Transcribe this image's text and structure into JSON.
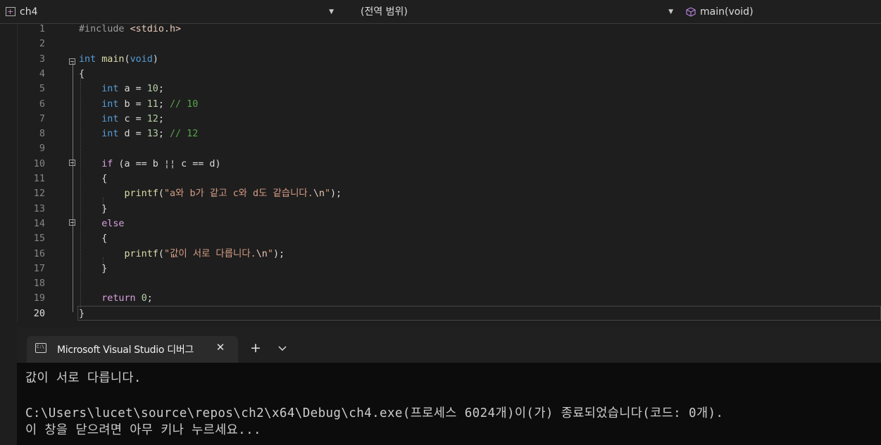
{
  "navbar": {
    "project": "ch4",
    "scope": "(전역 범위)",
    "member": "main(void)"
  },
  "editor": {
    "line_numbers": [
      "1",
      "2",
      "3",
      "4",
      "5",
      "6",
      "7",
      "8",
      "9",
      "10",
      "11",
      "12",
      "13",
      "14",
      "15",
      "16",
      "17",
      "18",
      "19",
      "20"
    ],
    "active_line": "20",
    "lines": [
      [
        {
          "t": "#include ",
          "c": "pp"
        },
        {
          "t": "<stdio.h>",
          "c": "inc"
        }
      ],
      [],
      [
        {
          "t": "int",
          "c": "kw"
        },
        {
          "t": " ",
          "c": ""
        },
        {
          "t": "main",
          "c": "fn"
        },
        {
          "t": "(",
          "c": ""
        },
        {
          "t": "void",
          "c": "kw"
        },
        {
          "t": ")",
          "c": ""
        }
      ],
      [
        {
          "t": "{",
          "c": ""
        }
      ],
      [
        {
          "t": "    ",
          "c": ""
        },
        {
          "t": "int",
          "c": "kw"
        },
        {
          "t": " a = ",
          "c": ""
        },
        {
          "t": "10",
          "c": "num"
        },
        {
          "t": ";",
          "c": ""
        }
      ],
      [
        {
          "t": "    ",
          "c": ""
        },
        {
          "t": "int",
          "c": "kw"
        },
        {
          "t": " b = ",
          "c": ""
        },
        {
          "t": "11",
          "c": "num"
        },
        {
          "t": "; ",
          "c": ""
        },
        {
          "t": "// 10",
          "c": "cmt"
        }
      ],
      [
        {
          "t": "    ",
          "c": ""
        },
        {
          "t": "int",
          "c": "kw"
        },
        {
          "t": " c = ",
          "c": ""
        },
        {
          "t": "12",
          "c": "num"
        },
        {
          "t": ";",
          "c": ""
        }
      ],
      [
        {
          "t": "    ",
          "c": ""
        },
        {
          "t": "int",
          "c": "kw"
        },
        {
          "t": " d = ",
          "c": ""
        },
        {
          "t": "13",
          "c": "num"
        },
        {
          "t": "; ",
          "c": ""
        },
        {
          "t": "// 12",
          "c": "cmt"
        }
      ],
      [],
      [
        {
          "t": "    ",
          "c": ""
        },
        {
          "t": "if",
          "c": "ctl"
        },
        {
          "t": " (a == b ¦¦ c == d)",
          "c": ""
        }
      ],
      [
        {
          "t": "    {",
          "c": ""
        }
      ],
      [
        {
          "t": "        ",
          "c": ""
        },
        {
          "t": "printf",
          "c": "fn"
        },
        {
          "t": "(",
          "c": ""
        },
        {
          "t": "\"a와 b가 같고 c와 d도 같습니다.",
          "c": "str"
        },
        {
          "t": "\\n",
          "c": "esc"
        },
        {
          "t": "\"",
          "c": "str"
        },
        {
          "t": ");",
          "c": ""
        }
      ],
      [
        {
          "t": "    }",
          "c": ""
        }
      ],
      [
        {
          "t": "    ",
          "c": ""
        },
        {
          "t": "else",
          "c": "ctl"
        }
      ],
      [
        {
          "t": "    {",
          "c": ""
        }
      ],
      [
        {
          "t": "        ",
          "c": ""
        },
        {
          "t": "printf",
          "c": "fn"
        },
        {
          "t": "(",
          "c": ""
        },
        {
          "t": "\"값이 서로 다릅니다.",
          "c": "str"
        },
        {
          "t": "\\n",
          "c": "esc"
        },
        {
          "t": "\"",
          "c": "str"
        },
        {
          "t": ");",
          "c": ""
        }
      ],
      [
        {
          "t": "    }",
          "c": ""
        }
      ],
      [],
      [
        {
          "t": "    ",
          "c": ""
        },
        {
          "t": "return",
          "c": "ctl"
        },
        {
          "t": " ",
          "c": ""
        },
        {
          "t": "0",
          "c": "num"
        },
        {
          "t": ";",
          "c": ""
        }
      ],
      [
        {
          "t": "}",
          "c": ""
        }
      ]
    ]
  },
  "terminal": {
    "tab_label": "Microsoft Visual Studio 디버그",
    "close_glyph": "✕",
    "new_tab_glyph": "+",
    "output_lines": [
      "값이 서로 다릅니다.",
      "",
      "C:\\Users\\lucet\\source\\repos\\ch2\\x64\\Debug\\ch4.exe(프로세스 6024개)이(가) 종료되었습니다(코드: 0개).",
      "이 창을 닫으려면 아무 키나 누르세요..."
    ]
  },
  "colors": {
    "keyword": "#569cd6",
    "control": "#d8a0df",
    "function": "#dcdcaa",
    "string": "#d69d85",
    "number": "#b5cea8",
    "comment": "#57a64a",
    "console_bg": "#0c0c0c"
  },
  "icons": {
    "project": "project-icon",
    "member": "cube-icon",
    "fold": "collapse-icon",
    "dropdown": "caret-down-icon",
    "tab": "console-icon"
  }
}
